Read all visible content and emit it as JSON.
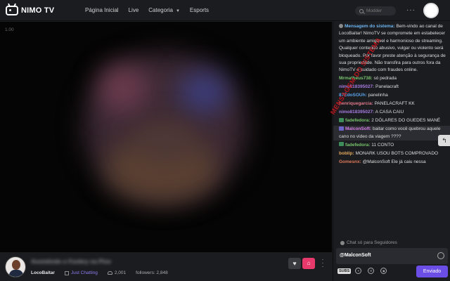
{
  "header": {
    "logo_text": "NIMO TV",
    "nav": [
      "Página Inicial",
      "Live",
      "Categoria",
      "Esports"
    ],
    "search_placeholder": "Modder"
  },
  "player": {
    "label": "1.00"
  },
  "stream": {
    "title": "Assistindo o Funkry na Pixe",
    "streamer": "LocoBaitar",
    "category": "Just Chatting",
    "viewers": "2,001",
    "followers": "followers: 2,848"
  },
  "chat": {
    "messages": [
      {
        "user": "Mensagem do sistema:",
        "text": " Bem-vindo ao canal de LocoBaitar! NimoTV se compromete em estabelecer um ambiente amigável e harmonioso de streaming. Qualquer conteúdo abusivo, vulgar ou violento será bloqueado. Por favor preste atenção à segurança de sua propriedade. Não transfira para outros fora da NimoTV e cuidado com fraudes online.",
        "color": "#6db5f0",
        "icon": "system"
      },
      {
        "user": "Mrmatheus738:",
        "text": " só pedrada",
        "color": "#79c46d"
      },
      {
        "user": "nimo818395027:",
        "text": " Panelacraft",
        "color": "#a67be0"
      },
      {
        "user": "87ÉdoSOUh:",
        "text": " panelinha",
        "color": "#5aa2e6"
      },
      {
        "user": "henriquegarcia:",
        "text": " PANELACRAFT KK",
        "color": "#e07a8a"
      },
      {
        "user": "nimo818395027:",
        "text": " A CASA CAIU",
        "color": "#a67be0"
      },
      {
        "user": "fadefedora:",
        "text": " 2 DÓLARES DO GUEDES MANÉ",
        "color": "#79c46d",
        "icon": "badge"
      },
      {
        "user": "MalconSoft:",
        "text": " baitar como você quebrou aquele cano no video da viagem ????",
        "color": "#d67ee8",
        "icon": "badge-purple",
        "highlight": true
      },
      {
        "user": "fadefedora:",
        "text": " 11 CONTO",
        "color": "#79c46d",
        "icon": "badge"
      },
      {
        "user": "boblip:",
        "text": " MONARK USOU BOTS COMPROVADO",
        "color": "#e3a85a"
      },
      {
        "user": "Gomesnx:",
        "text": " @MalconSoft Ele já caiu nessa",
        "color": "#e07a5a"
      }
    ],
    "stamp_text": "Mensagem do sistema",
    "follow_note": "Chat só para Seguidores",
    "input_value": "@MalconSoft",
    "subs_label": "SUBS",
    "send_label": "Enviado"
  }
}
